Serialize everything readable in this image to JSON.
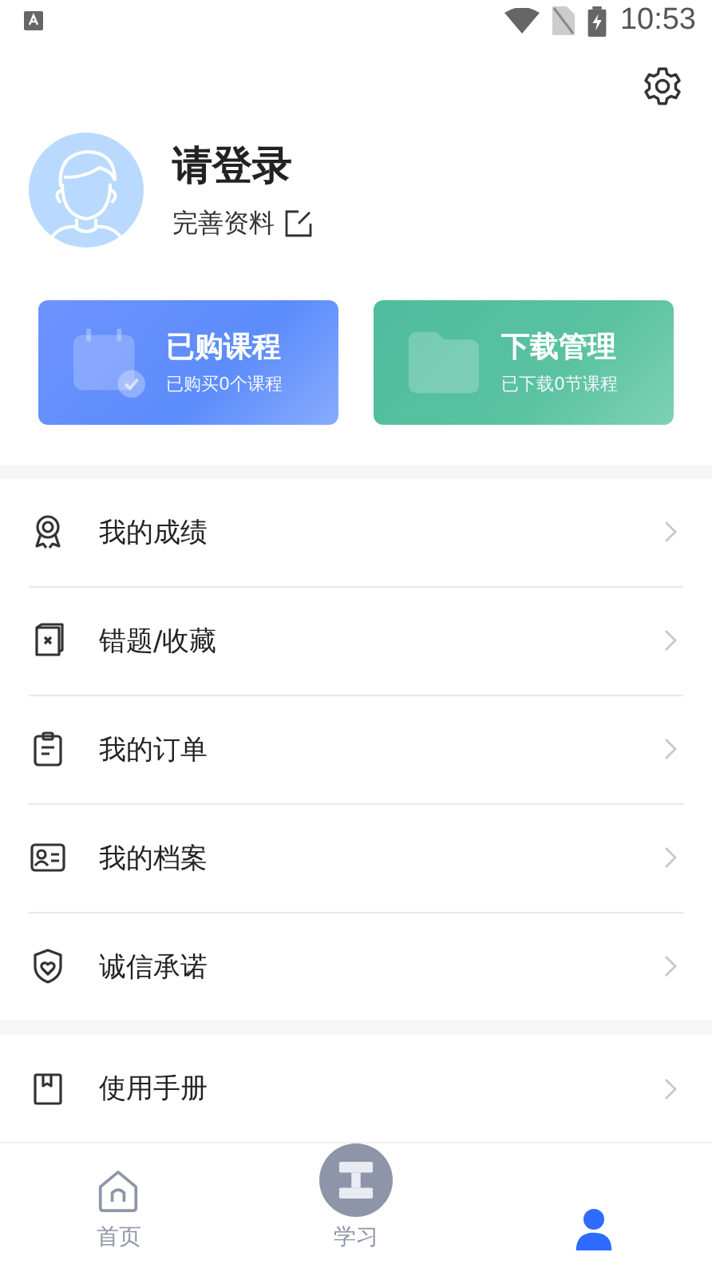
{
  "status_bar": {
    "time": "10:53"
  },
  "profile": {
    "name": "请登录",
    "edit_label": "完善资料"
  },
  "cards": [
    {
      "kind": "courses",
      "title": "已购课程",
      "subtitle": "已购买0个课程"
    },
    {
      "kind": "downloads",
      "title": "下载管理",
      "subtitle": "已下载0节课程"
    }
  ],
  "menu_groups": [
    {
      "items": [
        {
          "kind": "award",
          "label": "我的成绩"
        },
        {
          "kind": "mistakes",
          "label": "错题/收藏"
        },
        {
          "kind": "orders",
          "label": "我的订单"
        },
        {
          "kind": "profile",
          "label": "我的档案"
        },
        {
          "kind": "integrity",
          "label": "诚信承诺"
        }
      ]
    },
    {
      "items": [
        {
          "kind": "manual",
          "label": "使用手册"
        }
      ]
    }
  ],
  "tabs": [
    {
      "kind": "home",
      "label": "首页",
      "selected": false
    },
    {
      "kind": "study",
      "label": "学习",
      "selected": false
    },
    {
      "kind": "me",
      "selected": true
    }
  ]
}
